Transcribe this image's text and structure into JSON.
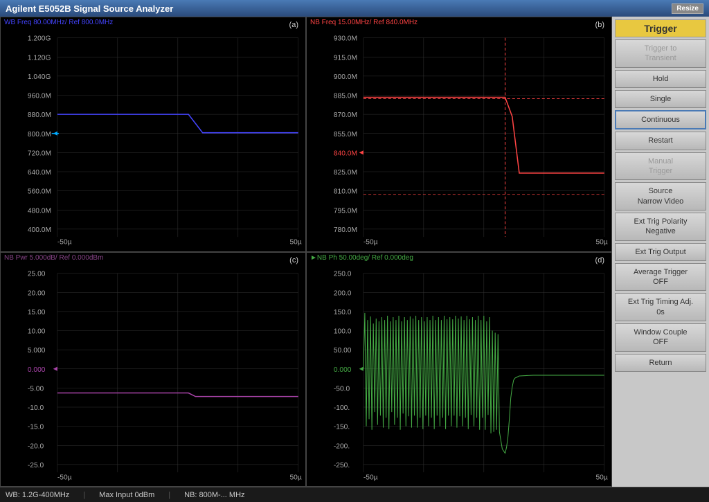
{
  "titlebar": {
    "title": "Agilent E5052B Signal Source Analyzer",
    "resize_label": "Resize"
  },
  "charts": {
    "a": {
      "title": "WB Freq 80.00MHz/ Ref 800.0MHz",
      "label": "(a)",
      "title_color": "#4444ff",
      "y_values": [
        "1.200G",
        "1.120G",
        "1.040G",
        "960.0M",
        "880.0M",
        "800.0M",
        "720.0M",
        "640.0M",
        "560.0M",
        "480.0M",
        "400.0M"
      ],
      "x_values": [
        "-50µ",
        "50µ"
      ],
      "ref_label": "800.0M"
    },
    "b": {
      "title": "NB Freq 15.00MHz/ Ref 840.0MHz",
      "label": "(b)",
      "title_color": "#ff4444",
      "y_values": [
        "930.0M",
        "915.0M",
        "900.0M",
        "885.0M",
        "870.0M",
        "855.0M",
        "840.0M",
        "825.0M",
        "810.0M",
        "795.0M",
        "780.0M"
      ],
      "x_values": [
        "-50µ",
        "50µ"
      ],
      "ref_label": "840.0M"
    },
    "c": {
      "title": "NB Pwr 5.000dB/ Ref 0.000dBm",
      "label": "(c)",
      "title_color": "#884488",
      "y_values": [
        "25.00",
        "20.00",
        "15.00",
        "10.00",
        "5.000",
        "0.000",
        "-5.00",
        "-10.0",
        "-15.0",
        "-20.0",
        "-25.0"
      ],
      "x_values": [
        "-50µ",
        "50µ"
      ],
      "ref_label": "0.000"
    },
    "d": {
      "title": "NB Ph 50.00deg/ Ref 0.000deg",
      "label": "(d)",
      "title_color": "#44aa44",
      "y_values": [
        "250.0",
        "200.0",
        "150.0",
        "100.0",
        "50.00",
        "0.000",
        "-50.0",
        "-100.",
        "-150.",
        "-200.",
        "-250."
      ],
      "x_values": [
        "-50µ",
        "50µ"
      ],
      "ref_label": "0.000"
    }
  },
  "sidebar": {
    "header": "Trigger",
    "buttons": [
      {
        "id": "trigger-to-transient",
        "label": "Trigger to\nTransient",
        "disabled": true
      },
      {
        "id": "hold",
        "label": "Hold"
      },
      {
        "id": "single",
        "label": "Single"
      },
      {
        "id": "continuous",
        "label": "Continuous",
        "highlighted": true
      },
      {
        "id": "restart",
        "label": "Restart"
      },
      {
        "id": "manual-trigger",
        "label": "Manual\nTrigger",
        "disabled": true
      },
      {
        "id": "source",
        "label": "Source\nNarrow Video"
      },
      {
        "id": "ext-trig-polarity",
        "label": "Ext Trig Polarity\nNegative"
      },
      {
        "id": "ext-trig-output",
        "label": "Ext Trig Output"
      },
      {
        "id": "average-trigger",
        "label": "Average Trigger\nOFF"
      },
      {
        "id": "ext-trig-timing",
        "label": "Ext Trig Timing Adj.\n0s"
      },
      {
        "id": "window-couple",
        "label": "Window Couple\nOFF"
      },
      {
        "id": "return",
        "label": "Return"
      }
    ]
  },
  "statusbar": {
    "left": "WB: 1.2G-400MHz",
    "center": "Max Input 0dBm",
    "right": "NB: 800M-... MHz"
  }
}
